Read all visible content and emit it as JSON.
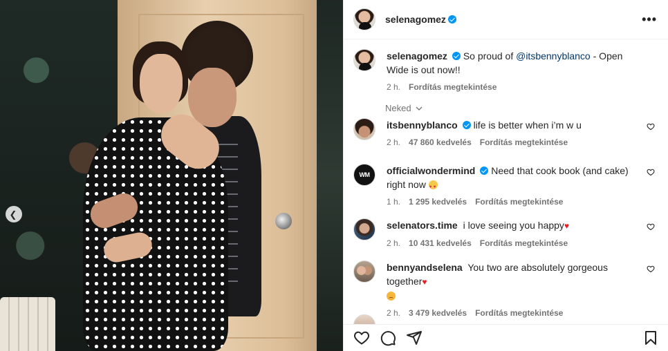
{
  "post": {
    "author": "selenagomez",
    "more_label": "•••",
    "caption": {
      "username": "selenagomez",
      "text_before": "So proud of ",
      "mention": "@itsbennyblanco",
      "text_after": " - Open Wide is out now!!",
      "time": "2 h.",
      "translate": "Fordítás megtekintése"
    },
    "for_you_label": "Neked"
  },
  "comments": [
    {
      "username": "itsbennyblanco",
      "text": "life is better when i’m w u",
      "time": "2 h.",
      "likes": "47 860 kedvelés",
      "translate": "Fordítás megtekintése"
    },
    {
      "username": "officialwondermind",
      "text": "Need that cook book (and cake) right now",
      "avatar_text": "WM",
      "time": "1 h.",
      "likes": "1 295 kedvelés",
      "translate": "Fordítás megtekintése"
    },
    {
      "username": "selenators.time",
      "text": "i love seeing you happy",
      "time": "2 h.",
      "likes": "10 431 kedvelés",
      "translate": "Fordítás megtekintése"
    },
    {
      "username": "bennyandselena",
      "text": "You two are absolutely gorgeous together",
      "time": "2 h.",
      "likes": "3 479 kedvelés",
      "translate": "Fordítás megtekintése"
    }
  ],
  "colors": {
    "verified": "#0095f6",
    "mention": "#00376b",
    "meta": "#737373",
    "heart_emoji": "#ed1c24"
  },
  "icons": {
    "carousel_prev": "chevron-left-icon",
    "like": "heart-outline-icon",
    "comment": "comment-bubble-icon",
    "share": "paper-plane-icon",
    "save": "bookmark-icon"
  }
}
